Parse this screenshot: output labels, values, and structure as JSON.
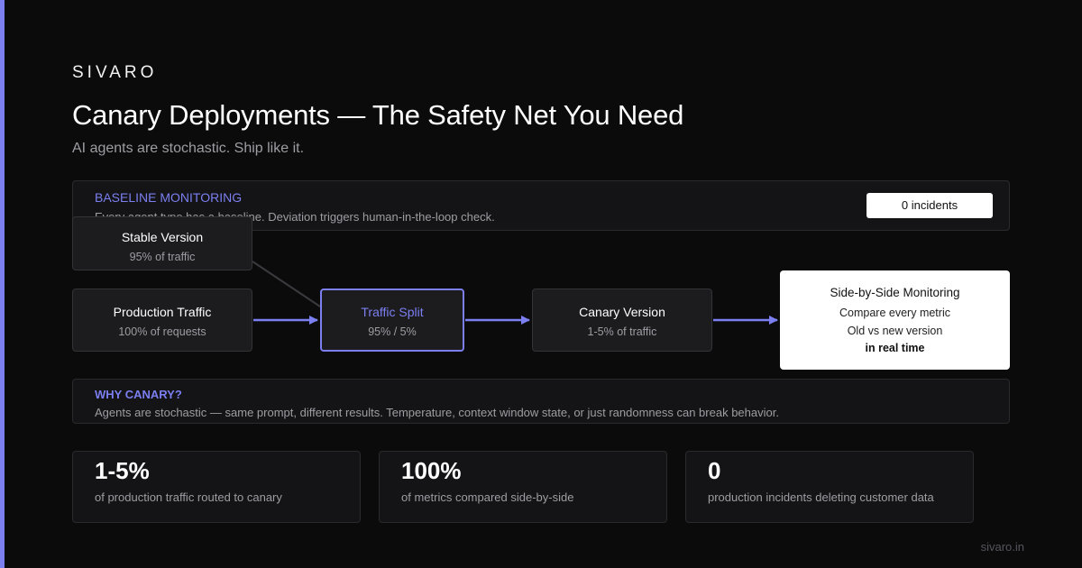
{
  "brand": "SIVARO",
  "title": "Canary Deployments — The Safety Net You Need",
  "subtitle": "AI agents are stochastic. Ship like it.",
  "baseline": {
    "heading": "BASELINE MONITORING",
    "text": "Every agent type has a baseline. Deviation triggers human-in-the-loop check.",
    "badge": "0 incidents"
  },
  "diagram": {
    "stable": {
      "title": "Stable Version",
      "sub": "95% of traffic"
    },
    "production": {
      "title": "Production Traffic",
      "sub": "100% of requests"
    },
    "split": {
      "title": "Traffic Split",
      "sub": "95% / 5%"
    },
    "canary": {
      "title": "Canary Version",
      "sub": "1-5% of traffic"
    },
    "monitor": {
      "title": "Side-by-Side Monitoring",
      "line1": "Compare every metric",
      "line2": "Old vs new version",
      "line3": "in real time"
    },
    "colors": {
      "accent": "#7b7ff0",
      "connector": "#3a3a3e"
    }
  },
  "why": {
    "heading": "WHY CANARY?",
    "text": "Agents are stochastic — same prompt, different results. Temperature, context window state, or just randomness can break behavior."
  },
  "stats": [
    {
      "value": "1-5%",
      "label": "of production traffic routed to canary"
    },
    {
      "value": "100%",
      "label": "of metrics compared side-by-side"
    },
    {
      "value": "0",
      "label": "production incidents deleting customer data"
    }
  ],
  "footer": "sivaro.in"
}
